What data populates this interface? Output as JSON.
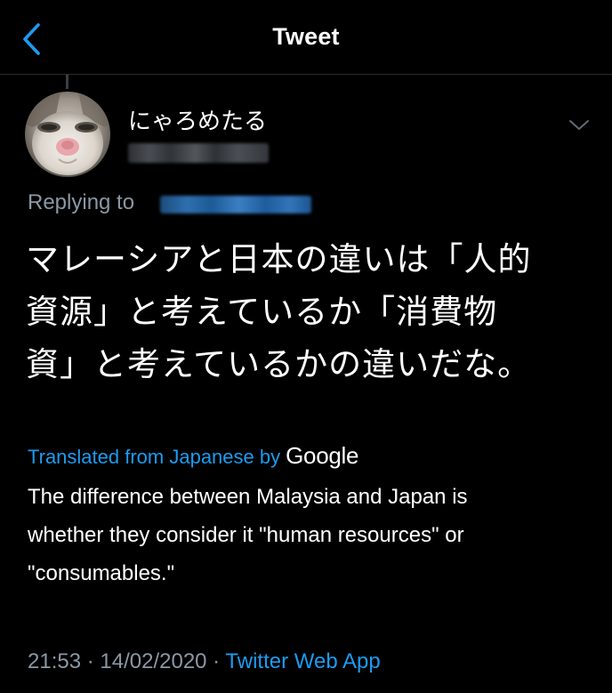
{
  "header": {
    "title": "Tweet",
    "back_icon": "chevron-left-icon"
  },
  "tweet": {
    "display_name": "にゃろめたる",
    "replying_to_label": "Replying to",
    "text": "マレーシアと日本の違いは「人的\n資源」と考えているか「消費物\n資」と考えているかの違いだな。",
    "translated_label": "Translated from Japanese by",
    "translator_brand": "Google",
    "translation": "The difference between Malaysia and Japan is\nwhether they consider it \"human resources\" or\n\"consumables.\"",
    "time": "21:53",
    "separator": " · ",
    "date": "14/02/2020",
    "source": "Twitter Web App",
    "more_icon": "chevron-down-icon"
  },
  "colors": {
    "background": "#000000",
    "text": "#ffffff",
    "secondary": "#8b98a5",
    "accent": "#1d9bf0"
  }
}
